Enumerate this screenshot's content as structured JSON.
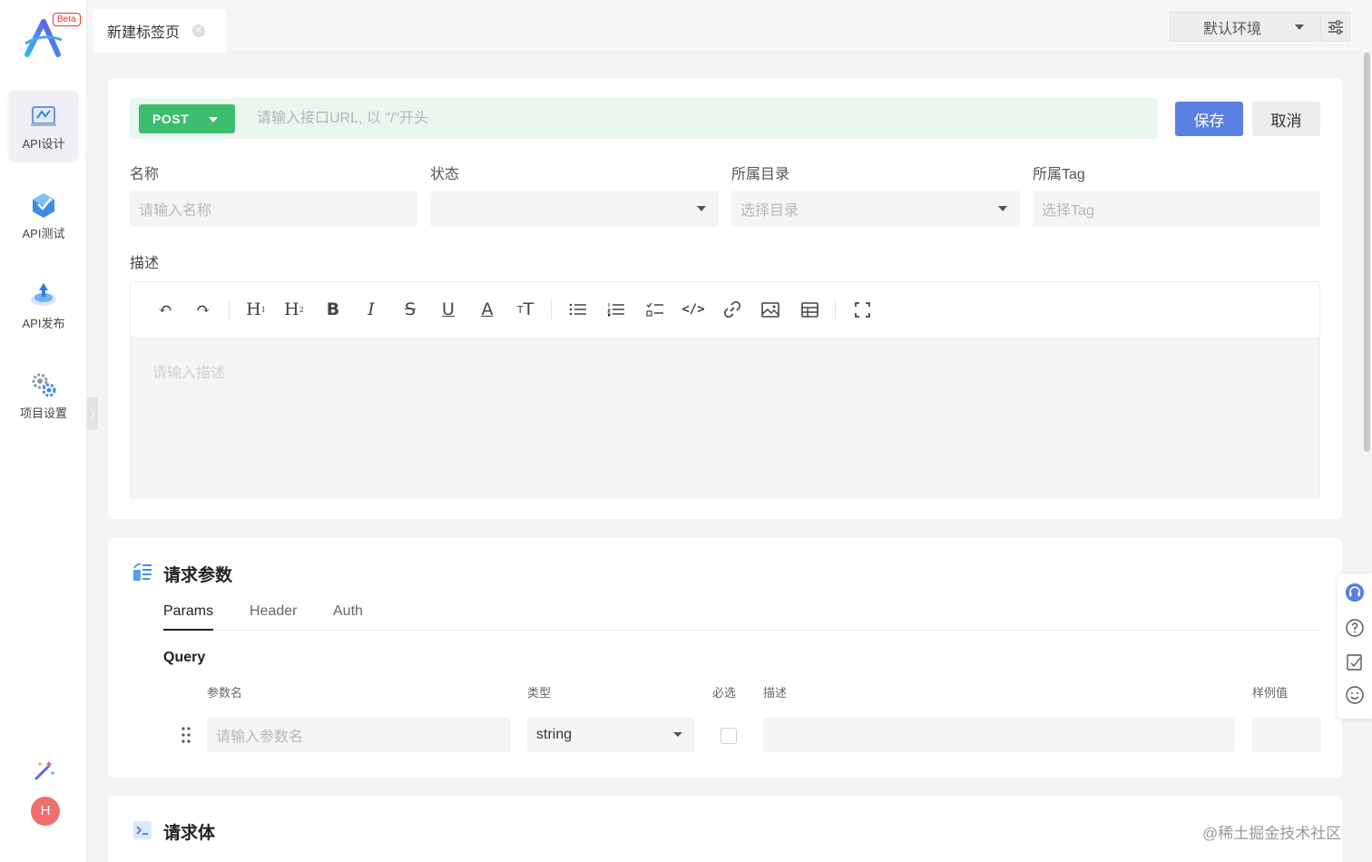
{
  "app": {
    "beta_badge": "Beta"
  },
  "sidebar": {
    "items": [
      {
        "label": "API设计",
        "icon": "api-design-icon",
        "active": true
      },
      {
        "label": "API测试",
        "icon": "api-test-icon",
        "active": false
      },
      {
        "label": "API发布",
        "icon": "api-publish-icon",
        "active": false
      },
      {
        "label": "项目设置",
        "icon": "project-settings-icon",
        "active": false
      }
    ],
    "user_initial": "H"
  },
  "tabs": [
    {
      "title": "新建标签页"
    }
  ],
  "environment": {
    "selected": "默认环境"
  },
  "request": {
    "method": "POST",
    "url_placeholder": "请输入接口URL, 以 \"/\"开头",
    "save_label": "保存",
    "cancel_label": "取消"
  },
  "fields": {
    "name": {
      "label": "名称",
      "placeholder": "请输入名称"
    },
    "status": {
      "label": "状态",
      "value": ""
    },
    "directory": {
      "label": "所属目录",
      "placeholder": "选择目录"
    },
    "tag": {
      "label": "所属Tag",
      "placeholder": "选择Tag"
    },
    "description": {
      "label": "描述",
      "placeholder": "请输入描述"
    }
  },
  "params_section": {
    "title": "请求参数",
    "tabs": [
      "Params",
      "Header",
      "Auth"
    ],
    "active_tab": "Params",
    "query_label": "Query",
    "columns": [
      "参数名",
      "类型",
      "必选",
      "描述",
      "样例值"
    ],
    "row": {
      "name_placeholder": "请输入参数名",
      "type": "string",
      "required": false
    }
  },
  "body_section": {
    "title": "请求体"
  },
  "watermark": "@稀土掘金技术社区",
  "colors": {
    "method_post": "#3dbe6f",
    "primary": "#5b80e3",
    "url_bar_bg": "#e9f7ef"
  }
}
